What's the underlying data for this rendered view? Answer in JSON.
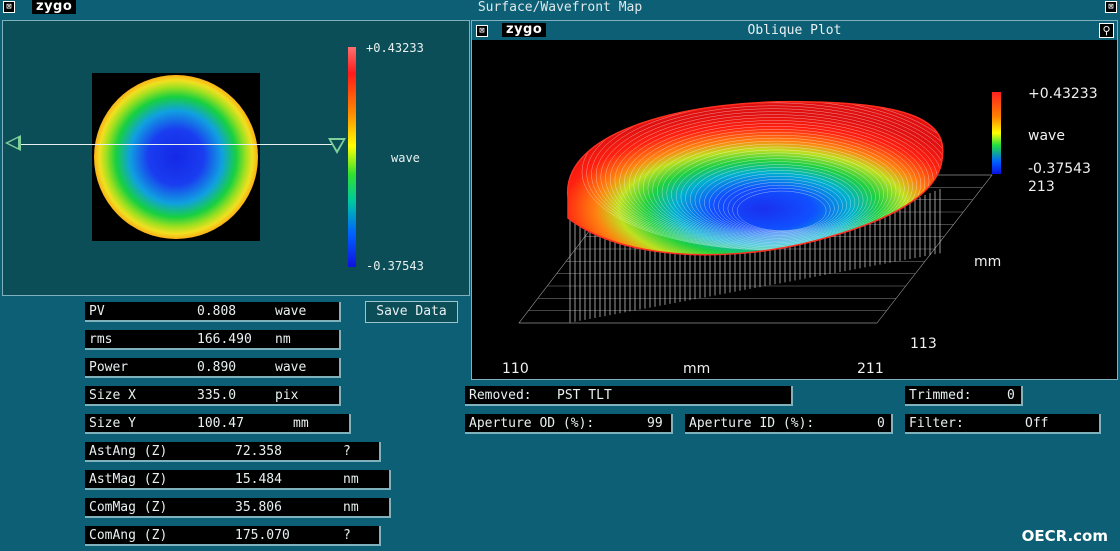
{
  "window": {
    "title": "Surface/Wavefront Map",
    "logo": "zygo"
  },
  "map_panel": {
    "color_max": "+0.43233",
    "color_min": "-0.37543",
    "color_unit": "wave"
  },
  "oblique_panel": {
    "title": "Oblique Plot",
    "logo": "zygo",
    "color_max": "+0.43233",
    "color_min": "-0.37543",
    "color_unit": "wave",
    "y_max_label": "213",
    "y_axis_label": "mm",
    "y_min_label": "113",
    "x_min_label": "110",
    "x_axis_label": "mm",
    "x_max_label": "211"
  },
  "stats": [
    {
      "label": "PV",
      "value": "0.808",
      "unit": "wave"
    },
    {
      "label": "rms",
      "value": "166.490",
      "unit": "nm"
    },
    {
      "label": "Power",
      "value": "0.890",
      "unit": "wave"
    },
    {
      "label": "Size X",
      "value": "335.0",
      "unit": "pix"
    },
    {
      "label": "Size Y",
      "value": "100.47",
      "unit": "mm"
    },
    {
      "label": "AstAng (Z)",
      "value": "72.358",
      "unit": "?"
    },
    {
      "label": "AstMag (Z)",
      "value": "15.484",
      "unit": "nm"
    },
    {
      "label": "ComMag (Z)",
      "value": "35.806",
      "unit": "nm"
    },
    {
      "label": "ComAng (Z)",
      "value": "175.070",
      "unit": "?"
    }
  ],
  "buttons": {
    "save_data": "Save Data"
  },
  "info": {
    "removed_label": "Removed:",
    "removed_value": "PST TLT",
    "trimmed_label": "Trimmed:",
    "trimmed_value": "0",
    "aperture_od_label": "Aperture OD (%):",
    "aperture_od_value": "99",
    "aperture_id_label": "Aperture ID (%):",
    "aperture_id_value": "0",
    "filter_label": "Filter:",
    "filter_value": "Off"
  },
  "watermark": "OECR.com",
  "colors": {
    "background": "#0d5f75",
    "panel": "#0c4e58",
    "field": "#000000",
    "text": "#e8f0f0"
  }
}
